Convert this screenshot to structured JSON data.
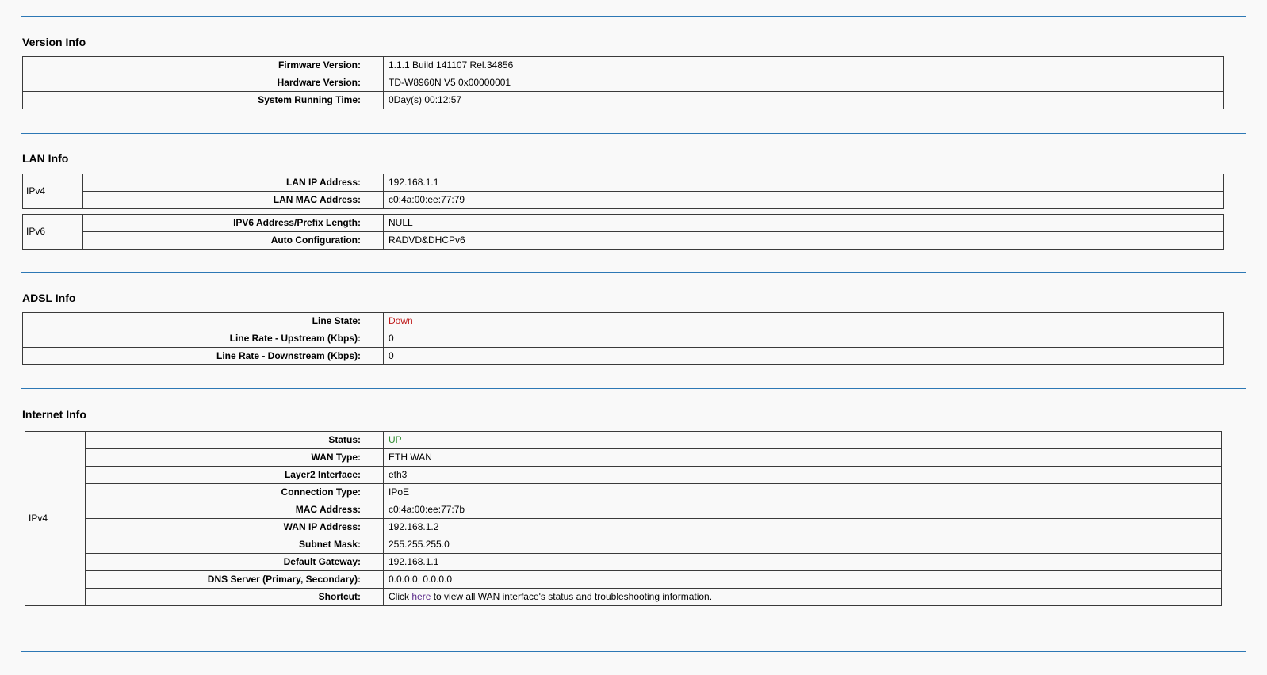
{
  "version_info": {
    "title": "Version Info",
    "rows": [
      {
        "label": "Firmware Version:",
        "value": "1.1.1 Build 141107 Rel.34856"
      },
      {
        "label": "Hardware Version:",
        "value": "TD-W8960N V5 0x00000001"
      },
      {
        "label": "System Running Time:",
        "value": "0Day(s) 00:12:57"
      }
    ]
  },
  "lan_info": {
    "title": "LAN Info",
    "ipv4": {
      "group": "IPv4",
      "rows": [
        {
          "label": "LAN IP Address:",
          "value": "192.168.1.1"
        },
        {
          "label": "LAN MAC Address:",
          "value": "c0:4a:00:ee:77:79"
        }
      ]
    },
    "ipv6": {
      "group": "IPv6",
      "rows": [
        {
          "label": "IPV6 Address/Prefix Length:",
          "value": "NULL"
        },
        {
          "label": "Auto Configuration:",
          "value": "RADVD&DHCPv6"
        }
      ]
    }
  },
  "adsl_info": {
    "title": "ADSL Info",
    "rows": [
      {
        "label": "Line State:",
        "value": "Down"
      },
      {
        "label": "Line Rate - Upstream (Kbps):",
        "value": "0"
      },
      {
        "label": "Line Rate - Downstream (Kbps):",
        "value": "0"
      }
    ]
  },
  "internet_info": {
    "title": "Internet Info",
    "group": "IPv4",
    "rows": [
      {
        "label": "Status:",
        "value": "UP"
      },
      {
        "label": "WAN Type:",
        "value": "ETH WAN"
      },
      {
        "label": "Layer2 Interface:",
        "value": "eth3"
      },
      {
        "label": "Connection Type:",
        "value": "IPoE"
      },
      {
        "label": "MAC Address:",
        "value": "c0:4a:00:ee:77:7b"
      },
      {
        "label": "WAN IP Address:",
        "value": "192.168.1.2"
      },
      {
        "label": "Subnet Mask:",
        "value": "255.255.255.0"
      },
      {
        "label": "Default Gateway:",
        "value": "192.168.1.1"
      },
      {
        "label": "DNS Server (Primary, Secondary):",
        "value": "0.0.0.0, 0.0.0.0"
      }
    ],
    "shortcut": {
      "label": "Shortcut:",
      "text_before": "Click ",
      "link_text": "here",
      "text_after": " to view all WAN interface's status and troubleshooting information."
    }
  },
  "colors": {
    "rule": "#2d78b5",
    "status_down": "#c01d1d",
    "status_up": "#2e8b2e",
    "link": "#5a2a8a"
  }
}
